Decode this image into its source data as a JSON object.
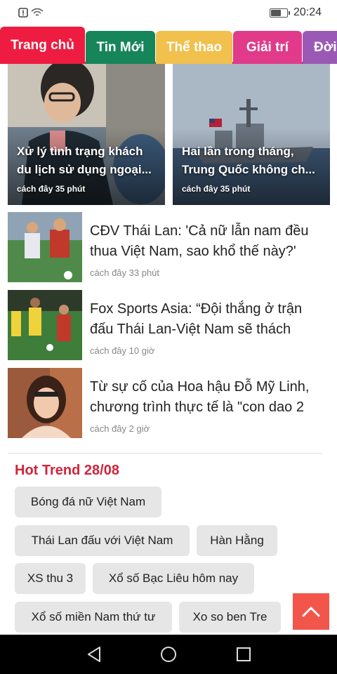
{
  "status_bar": {
    "time": "20:24",
    "battery_level": 0.6,
    "icons": [
      "alert-icon",
      "wifi-icon",
      "battery-icon"
    ]
  },
  "tabs": [
    {
      "label": "Trang chủ",
      "color": "#ed1c40",
      "active": true
    },
    {
      "label": "Tin Mới",
      "color": "#16855a",
      "active": false
    },
    {
      "label": "Thể thao",
      "color": "#f1c04d",
      "active": false
    },
    {
      "label": "Giải trí",
      "color": "#e13a8a",
      "active": false
    },
    {
      "label": "Đời",
      "color": "#9b59b6",
      "active": false
    }
  ],
  "featured": [
    {
      "title": "Xử lý tình trạng khách du lịch sử dụng ngoại...",
      "time": "cách đây 35 phút"
    },
    {
      "title": "Hai lần trong tháng, Trung Quốc không ch...",
      "time": "cách đây 35 phút"
    }
  ],
  "articles": [
    {
      "title": "CĐV Thái Lan: 'Cả nữ lẫn nam đều thua Việt Nam, sao khổ thế này?'",
      "time": "cách đây 33 phút"
    },
    {
      "title": "Fox Sports Asia: “Đội thắng ở trận đấu Thái Lan-Việt Nam sẽ thách",
      "time": "cách đây 10 giờ"
    },
    {
      "title": "Từ sự cố của Hoa hậu Đỗ Mỹ Linh, chương trình thực tế là \"con dao 2",
      "time": "cách đây 2 giờ"
    }
  ],
  "hot_trend": {
    "title": "Hot Trend 28/08",
    "tags": [
      "Bóng đá nữ Việt Nam",
      "Thái Lan đấu với Việt Nam",
      "Hàn Hằng",
      "XS thu 3",
      "Xổ số Bạc Liêu hôm nay",
      "Xổ số miền Nam thứ tư",
      "Xo so ben Tre"
    ]
  },
  "colors": {
    "accent": "#ed1c40",
    "hot_trend": "#d0243a",
    "scroll_top": "#f2564b"
  }
}
